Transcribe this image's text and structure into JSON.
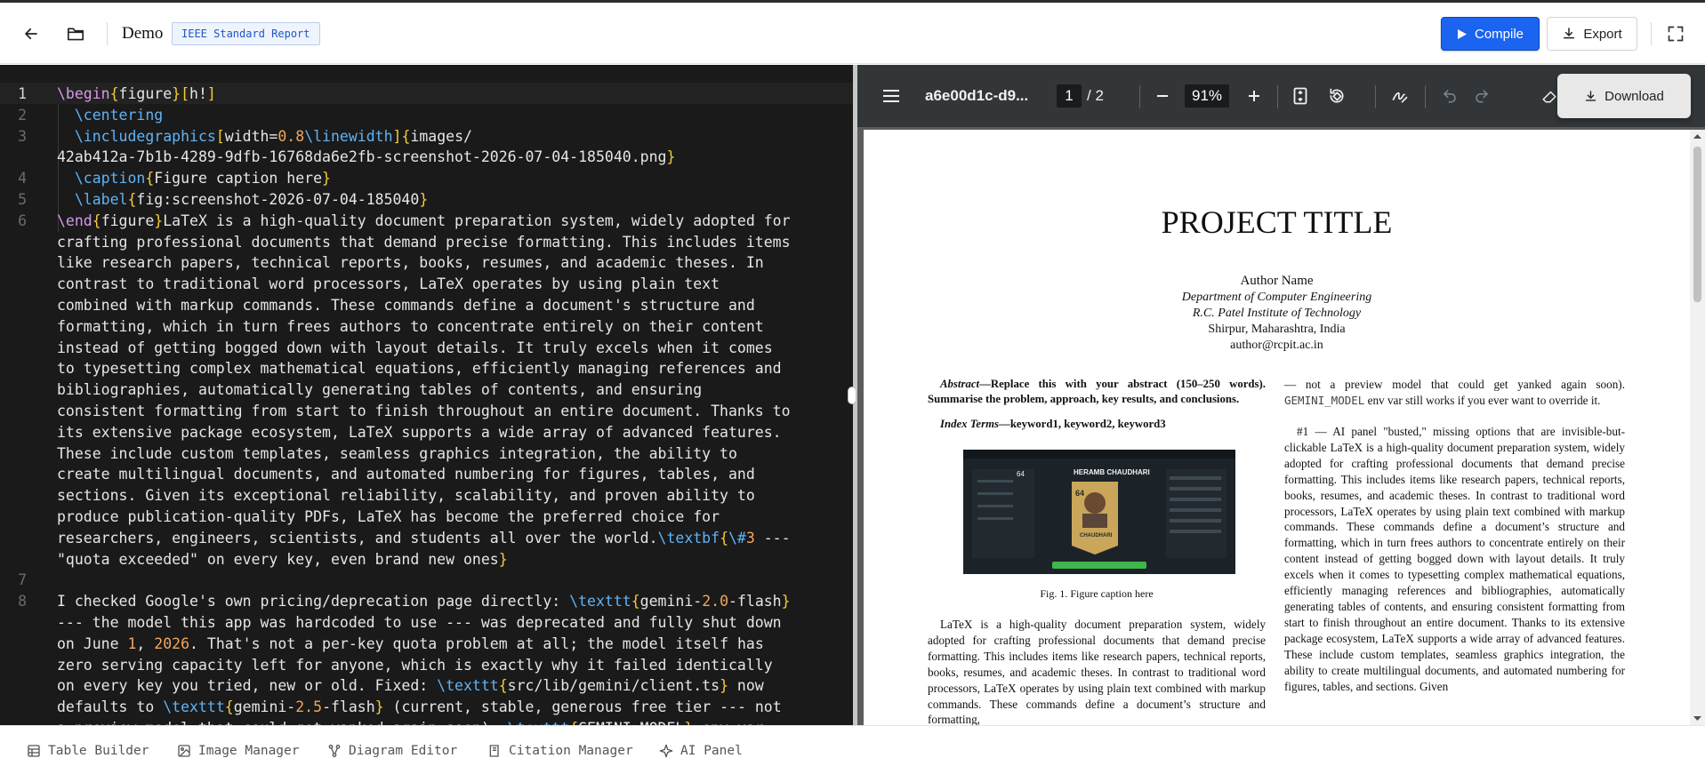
{
  "header": {
    "title": "Demo",
    "template_badge": "IEEE Standard Report",
    "compile_label": "Compile",
    "export_label": "Export"
  },
  "editor": {
    "line_numbers": [
      "1",
      "2",
      "3",
      "4",
      "5",
      "6",
      "7",
      "8"
    ],
    "lines": [
      [
        [
          "k",
          "\\begin"
        ],
        [
          "b",
          "{"
        ],
        [
          "t",
          "figure"
        ],
        [
          "b",
          "}"
        ],
        [
          "b",
          "["
        ],
        [
          "t",
          "h!"
        ],
        [
          "b",
          "]"
        ]
      ],
      [
        [
          "t",
          "  "
        ],
        [
          "c",
          "\\centering"
        ]
      ],
      [
        [
          "t",
          "  "
        ],
        [
          "c",
          "\\includegraphics"
        ],
        [
          "b",
          "["
        ],
        [
          "t",
          "width="
        ],
        [
          "n",
          "0.8"
        ],
        [
          "c",
          "\\linewidth"
        ],
        [
          "b",
          "]"
        ],
        [
          "b",
          "{"
        ],
        [
          "t",
          "images/"
        ]
      ],
      [
        [
          "t",
          "42ab412a-7b1b-4289-9dfb-16768da6e2fb-screenshot-2026-07-04-185040.png"
        ],
        [
          "b",
          "}"
        ]
      ],
      [
        [
          "t",
          "  "
        ],
        [
          "c",
          "\\caption"
        ],
        [
          "b",
          "{"
        ],
        [
          "t",
          "Figure caption here"
        ],
        [
          "b",
          "}"
        ]
      ],
      [
        [
          "t",
          "  "
        ],
        [
          "c",
          "\\label"
        ],
        [
          "b",
          "{"
        ],
        [
          "t",
          "fig:screenshot-2026-07-04-185040"
        ],
        [
          "b",
          "}"
        ]
      ],
      [
        [
          "k",
          "\\end"
        ],
        [
          "b",
          "{"
        ],
        [
          "t",
          "figure"
        ],
        [
          "b",
          "}"
        ],
        [
          "t",
          "LaTeX is a high-quality document preparation system, widely adopted for"
        ]
      ],
      [
        [
          "t",
          "crafting professional documents that demand precise formatting. This includes items"
        ]
      ],
      [
        [
          "t",
          "like research papers, technical reports, books, resumes, and academic theses. In"
        ]
      ],
      [
        [
          "t",
          "contrast to traditional word processors, LaTeX operates by using plain text"
        ]
      ],
      [
        [
          "t",
          "combined with markup commands. These commands define a document's structure and"
        ]
      ],
      [
        [
          "t",
          "formatting, which in turn frees authors to concentrate entirely on their content"
        ]
      ],
      [
        [
          "t",
          "instead of getting bogged down with layout details. It truly excels when it comes"
        ]
      ],
      [
        [
          "t",
          "to typesetting complex mathematical equations, efficiently managing references and"
        ]
      ],
      [
        [
          "t",
          "bibliographies, automatically generating tables of contents, and ensuring"
        ]
      ],
      [
        [
          "t",
          "consistent formatting from start to finish throughout an entire document. Thanks to"
        ]
      ],
      [
        [
          "t",
          "its extensive package ecosystem, LaTeX supports a wide array of advanced features."
        ]
      ],
      [
        [
          "t",
          "These include custom templates, seamless graphics integration, the ability to"
        ]
      ],
      [
        [
          "t",
          "create multilingual documents, and automated numbering for figures, tables, and"
        ]
      ],
      [
        [
          "t",
          "sections. Given its exceptional reliability, scalability, and proven ability to"
        ]
      ],
      [
        [
          "t",
          "produce publication-quality PDFs, LaTeX has become the preferred choice for"
        ]
      ],
      [
        [
          "t",
          "researchers, engineers, scientists, and students all over the world."
        ],
        [
          "c",
          "\\textbf"
        ],
        [
          "b",
          "{"
        ],
        [
          "c",
          "\\#"
        ],
        [
          "n",
          "3"
        ],
        [
          "t",
          " ---"
        ]
      ],
      [
        [
          "t",
          "\"quota exceeded\" on every key, even brand new ones"
        ],
        [
          "b",
          "}"
        ]
      ],
      [],
      [
        [
          "t",
          "I checked Google's own pricing/deprecation page directly: "
        ],
        [
          "c",
          "\\texttt"
        ],
        [
          "b",
          "{"
        ],
        [
          "t",
          "gemini-"
        ],
        [
          "n",
          "2.0"
        ],
        [
          "t",
          "-flash"
        ],
        [
          "b",
          "}"
        ]
      ],
      [
        [
          "t",
          "--- the model this app was hardcoded to use --- was deprecated and fully shut down"
        ]
      ],
      [
        [
          "t",
          "on June "
        ],
        [
          "n",
          "1"
        ],
        [
          "t",
          ", "
        ],
        [
          "n",
          "2026"
        ],
        [
          "t",
          ". That's not a per-key quota problem at all; the model itself has"
        ]
      ],
      [
        [
          "t",
          "zero serving capacity left for anyone, which is exactly why it failed identically"
        ]
      ],
      [
        [
          "t",
          "on every key you tried, new or old. Fixed: "
        ],
        [
          "c",
          "\\texttt"
        ],
        [
          "b",
          "{"
        ],
        [
          "t",
          "src/lib/gemini/client.ts"
        ],
        [
          "b",
          "}"
        ],
        [
          "t",
          " now"
        ]
      ],
      [
        [
          "t",
          "defaults to "
        ],
        [
          "c",
          "\\texttt"
        ],
        [
          "b",
          "{"
        ],
        [
          "t",
          "gemini-"
        ],
        [
          "n",
          "2.5"
        ],
        [
          "t",
          "-flash"
        ],
        [
          "b",
          "}"
        ],
        [
          "t",
          " (current, stable, generous free tier --- not"
        ]
      ],
      [
        [
          "t",
          "a preview model that could get yanked again soon). "
        ],
        [
          "c",
          "\\texttt"
        ],
        [
          "b",
          "{"
        ],
        [
          "t",
          "GEMINI_MODEL"
        ],
        [
          "b",
          "}"
        ],
        [
          "t",
          " env var"
        ]
      ]
    ]
  },
  "pdf": {
    "filename": "a6e00d1c-d9...",
    "page_current": "1",
    "page_total": "/ 2",
    "zoom": "91%",
    "download_label": "Download",
    "title": "PROJECT TITLE",
    "author": "Author Name",
    "department": "Department of Computer Engineering",
    "institute": "R.C. Patel Institute of Technology",
    "location": "Shirpur, Maharashtra, India",
    "email": "author@rcpit.ac.in",
    "abstract_label": "Abstract",
    "abstract_text": "—Replace this with your abstract (150–250 words). Summarise the problem, approach, key results, and conclusions.",
    "index_label": "Index Terms",
    "index_text": "—keyword1, keyword2, keyword3",
    "figure_caption": "Fig. 1.  Figure caption here",
    "figure_card_name": "HERAMB CHAUDHARI",
    "figure_card_rating": "64",
    "figure_card_label": "CHAUDHARI",
    "left_body": "LaTeX is a high-quality document preparation system, widely adopted for crafting professional documents that demand precise formatting. This includes items like research papers, technical reports, books, resumes, and academic theses. In contrast to traditional word processors, LaTeX operates by using plain text combined with markup commands. These commands define a document’s structure and formatting,",
    "right_pre": "— not a preview model that could get yanked again soon).",
    "right_mono": "GEMINI_MODEL",
    "right_post": " env var still works if you ever want to override it.",
    "right_body": "#1 — AI panel \"busted,\" missing options that are invisible-but-clickable LaTeX is a high-quality document preparation system, widely adopted for crafting professional documents that demand precise formatting. This includes items like research papers, technical reports, books, resumes, and academic theses. In contrast to traditional word processors, LaTeX operates by using plain text combined with markup commands. These commands define a document’s structure and formatting, which in turn frees authors to concentrate entirely on their content instead of getting bogged down with layout details. It truly excels when it comes to typesetting complex mathematical equations, efficiently managing references and bibliographies, automatically generating tables of contents, and ensuring consistent formatting from start to finish throughout an entire document. Thanks to its extensive package ecosystem, LaTeX supports a wide array of advanced features. These include custom templates, seamless graphics integration, the ability to create multilingual documents, and automated numbering for figures, tables, and sections. Given"
  },
  "bottom_tabs": [
    {
      "label": "Table Builder",
      "icon": "table-icon"
    },
    {
      "label": "Image Manager",
      "icon": "image-icon"
    },
    {
      "label": "Diagram Editor",
      "icon": "diagram-icon"
    },
    {
      "label": "Citation Manager",
      "icon": "book-icon"
    },
    {
      "label": "AI Panel",
      "icon": "sparkle-icon"
    }
  ],
  "colors": {
    "accent": "#1a64ef",
    "editor_bg": "#1a1a1a",
    "pdf_toolbar": "#323639"
  }
}
